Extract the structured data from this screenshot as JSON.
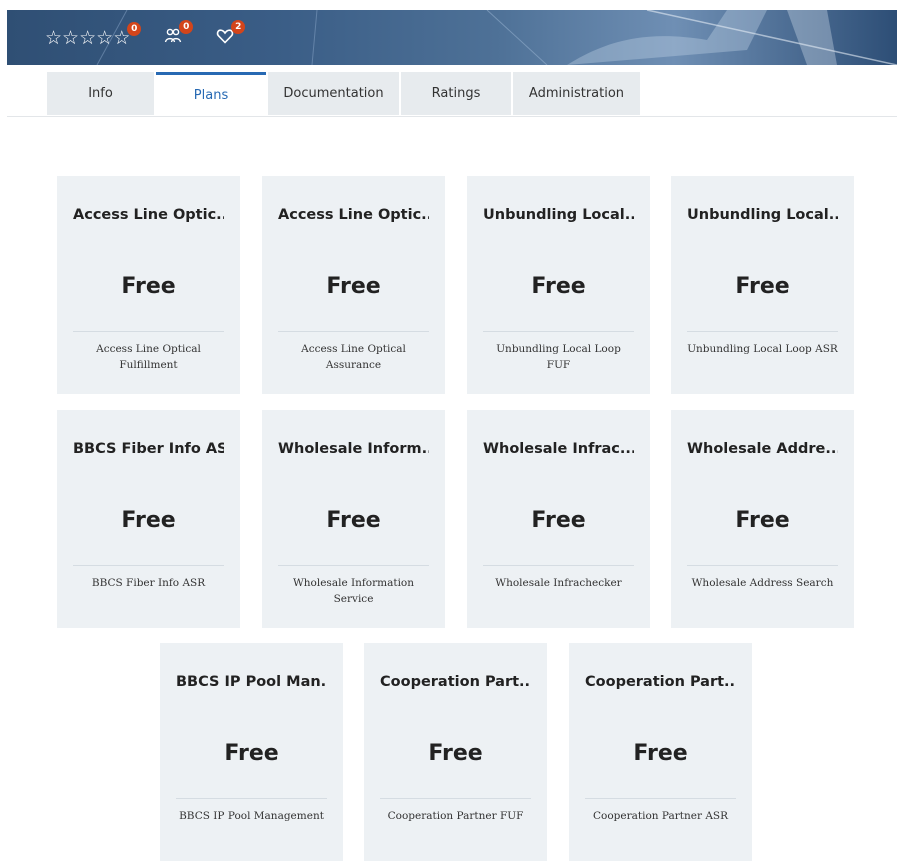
{
  "header": {
    "stats": [
      {
        "kind": "rating",
        "count": "0"
      },
      {
        "kind": "subscribers",
        "count": "0"
      },
      {
        "kind": "favorites",
        "count": "2"
      }
    ],
    "stars": [
      "☆",
      "☆",
      "☆",
      "☆",
      "☆"
    ]
  },
  "tabs": [
    {
      "label": "Info",
      "active": false
    },
    {
      "label": "Plans",
      "active": true
    },
    {
      "label": "Documentation",
      "active": false
    },
    {
      "label": "Ratings",
      "active": false
    },
    {
      "label": "Administration",
      "active": false
    }
  ],
  "plans": [
    {
      "title": "Access Line Optic...",
      "price": "Free",
      "description": "Access Line Optical Fulfillment"
    },
    {
      "title": "Access Line Optic...",
      "price": "Free",
      "description": "Access Line Optical Assurance"
    },
    {
      "title": "Unbundling Local...",
      "price": "Free",
      "description": "Unbundling Local Loop FUF"
    },
    {
      "title": "Unbundling Local...",
      "price": "Free",
      "description": "Unbundling Local Loop ASR"
    },
    {
      "title": "BBCS Fiber Info ASR",
      "price": "Free",
      "description": "BBCS Fiber Info ASR"
    },
    {
      "title": "Wholesale Inform...",
      "price": "Free",
      "description": "Wholesale Information Service"
    },
    {
      "title": "Wholesale Infrac...",
      "price": "Free",
      "description": "Wholesale Infrachecker"
    },
    {
      "title": "Wholesale Addre...",
      "price": "Free",
      "description": "Wholesale Address Search"
    },
    {
      "title": "BBCS IP Pool Man...",
      "price": "Free",
      "description": "BBCS IP Pool Management"
    },
    {
      "title": "Cooperation Part...",
      "price": "Free",
      "description": "Cooperation Partner FUF"
    },
    {
      "title": "Cooperation Part...",
      "price": "Free",
      "description": "Cooperation Partner ASR"
    }
  ],
  "icons": {
    "subscribers": "users-icon",
    "favorites": "heart-icon",
    "rating": "star-icon"
  },
  "colors": {
    "accent": "#2769b3",
    "badge": "#d3451b",
    "card_bg": "#edf1f4",
    "tab_bg": "#e7ebee"
  }
}
